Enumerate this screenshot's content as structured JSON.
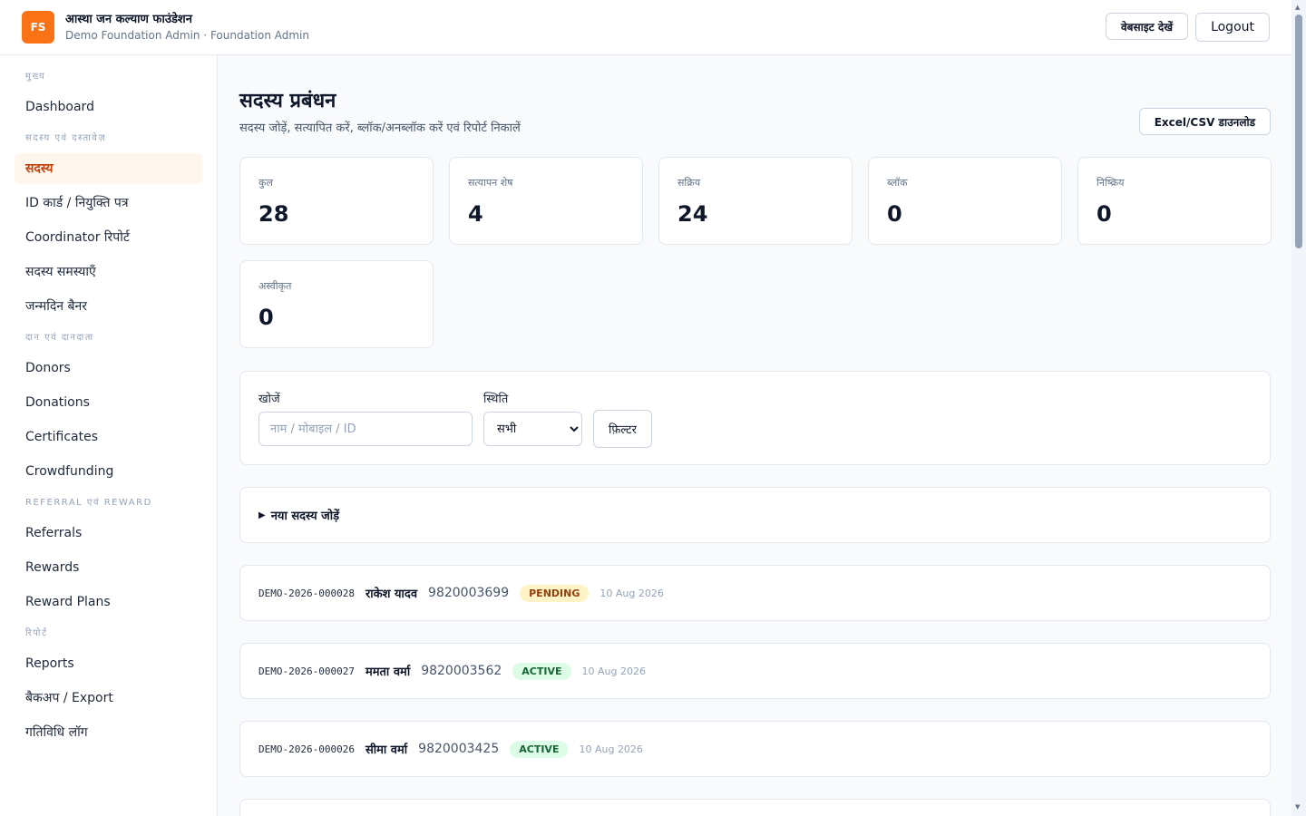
{
  "header": {
    "logo_text": "FS",
    "brand_name": "आस्था जन कल्याण फाउंडेशन",
    "brand_sub": "Demo Foundation Admin · Foundation Admin",
    "view_site_label": "वेबसाइट देखें",
    "logout_label": "Logout"
  },
  "sidebar": {
    "sections": [
      {
        "title": "मुख्य",
        "items": [
          "Dashboard"
        ]
      },
      {
        "title": "सदस्य एवं दस्तावेज़",
        "items": [
          "सदस्य",
          "ID कार्ड / नियुक्ति पत्र",
          "Coordinator रिपोर्ट",
          "सदस्य समस्याएँ",
          "जन्मदिन बैनर"
        ]
      },
      {
        "title": "दान एवं दानदाता",
        "items": [
          "Donors",
          "Donations",
          "Certificates",
          "Crowdfunding"
        ]
      },
      {
        "title": "REFERRAL एवं REWARD",
        "items": [
          "Referrals",
          "Rewards",
          "Reward Plans"
        ]
      },
      {
        "title": "रिपोर्ट",
        "items": [
          "Reports",
          "बैकअप / Export",
          "गतिविधि लॉग"
        ]
      }
    ],
    "active_item": "सदस्य"
  },
  "page": {
    "title": "सदस्य प्रबंधन",
    "subtitle": "सदस्य जोड़ें, सत्यापित करें, ब्लॉक/अनब्लॉक करें एवं रिपोर्ट निकालें",
    "download_label": "Excel/CSV डाउनलोड"
  },
  "stats": [
    {
      "label": "कुल",
      "value": "28"
    },
    {
      "label": "सत्यापन शेष",
      "value": "4"
    },
    {
      "label": "सक्रिय",
      "value": "24"
    },
    {
      "label": "ब्लॉक",
      "value": "0"
    },
    {
      "label": "निष्क्रिय",
      "value": "0"
    },
    {
      "label": "अस्वीकृत",
      "value": "0"
    }
  ],
  "filter": {
    "search_label": "खोजें",
    "search_placeholder": "नाम / मोबाइल / ID",
    "search_value": "",
    "status_label": "स्थिति",
    "status_value": "सभी",
    "filter_button": "फ़िल्टर"
  },
  "add_member": {
    "label": "नया सदस्य जोड़ें"
  },
  "members": [
    {
      "id": "DEMO-2026-000028",
      "name": "राकेश यादव",
      "phone": "9820003699",
      "status": "PENDING",
      "date": "10 Aug 2026"
    },
    {
      "id": "DEMO-2026-000027",
      "name": "ममता वर्मा",
      "phone": "9820003562",
      "status": "ACTIVE",
      "date": "10 Aug 2026"
    },
    {
      "id": "DEMO-2026-000026",
      "name": "सीमा वर्मा",
      "phone": "9820003425",
      "status": "ACTIVE",
      "date": "10 Aug 2026"
    }
  ],
  "colors": {
    "accent": "#f97316",
    "active_nav_bg": "#fff7ed",
    "pending_bg": "#fef3c7",
    "active_bg": "#dcfce7"
  }
}
